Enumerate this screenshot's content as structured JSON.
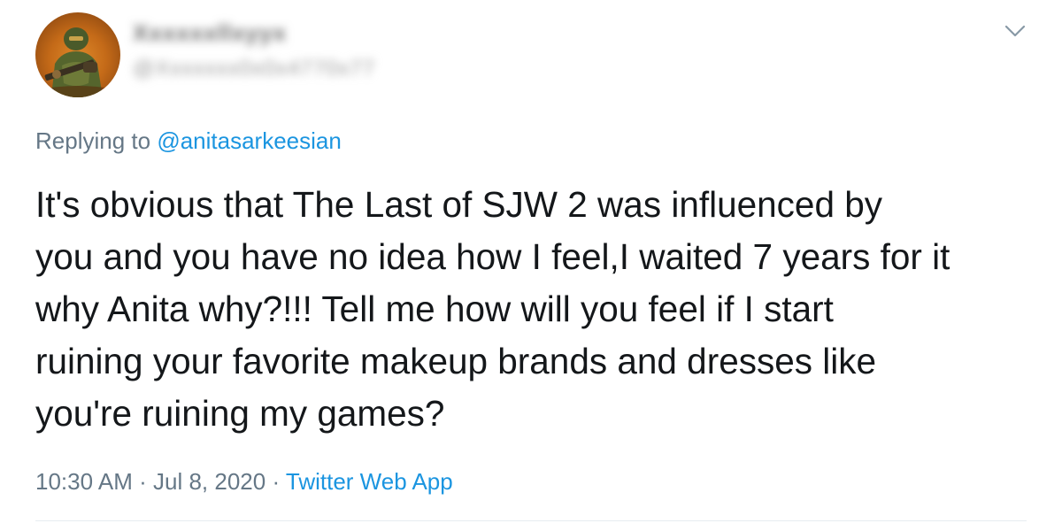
{
  "author": {
    "avatar_icon": "doom-marine-avatar-icon",
    "display_name": "Xxxxxxllxyyx",
    "handle": "@Xxxxxxx0x0x4770x77"
  },
  "menu_icon": "chevron-down-icon",
  "reply": {
    "prefix": "Replying to",
    "handle": "@anitasarkeesian"
  },
  "tweet": {
    "lines": [
      "It's obvious that The Last of SJW 2 was influenced by",
      "you and you have no idea how I feel,I waited 7 years for it",
      "why Anita why?!!! Tell me how will you feel if I start",
      "ruining your favorite makeup brands and dresses like",
      "you're ruining my games?"
    ]
  },
  "meta": {
    "time": "10:30 AM",
    "separator": "·",
    "date": "Jul 8, 2020",
    "source": "Twitter Web App"
  },
  "colors": {
    "text": "#14171a",
    "secondary": "#657786",
    "link": "#1b95e0",
    "divider": "#e6ecf0"
  }
}
